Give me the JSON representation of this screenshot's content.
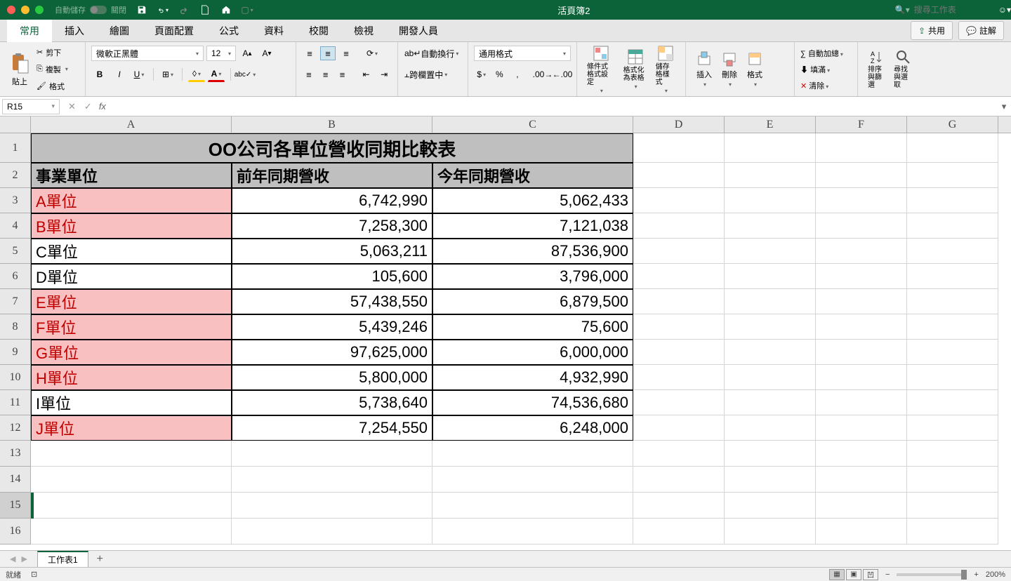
{
  "window": {
    "title": "活頁簿2",
    "autosave_label": "自動儲存",
    "autosave_state": "關閉",
    "search_placeholder": "搜尋工作表"
  },
  "ribbon_tabs": {
    "home": "常用",
    "insert": "插入",
    "draw": "繪圖",
    "page_layout": "頁面配置",
    "formulas": "公式",
    "data": "資料",
    "review": "校閱",
    "view": "檢視",
    "developer": "開發人員",
    "share": "共用",
    "comments": "註解"
  },
  "ribbon": {
    "clipboard": {
      "paste": "貼上",
      "cut": "剪下",
      "copy": "複製",
      "format": "格式"
    },
    "font": {
      "name": "微軟正黑體",
      "size": "12"
    },
    "alignment": {
      "wrap": "自動換行",
      "merge": "跨欄置中"
    },
    "number": {
      "format": "通用格式"
    },
    "styles": {
      "cond": "條件式格式設定",
      "table": "格式化為表格",
      "cell": "儲存格樣式"
    },
    "cells": {
      "insert": "插入",
      "delete": "刪除",
      "format": "格式"
    },
    "editing": {
      "autosum": "自動加總",
      "fill": "填滿",
      "clear": "清除",
      "sort": "排序與篩選",
      "find": "尋找與選取"
    }
  },
  "formula_bar": {
    "name_box": "R15"
  },
  "columns": [
    "A",
    "B",
    "C",
    "D",
    "E",
    "F",
    "G"
  ],
  "data": {
    "title": "OO公司各單位營收同期比較表",
    "h1": "事業單位",
    "h2": "前年同期營收",
    "h3": "今年同期營收",
    "rows": [
      {
        "unit": "A單位",
        "prev": "6,742,990",
        "curr": "5,062,433",
        "hl": true
      },
      {
        "unit": "B單位",
        "prev": "7,258,300",
        "curr": "7,121,038",
        "hl": true
      },
      {
        "unit": "C單位",
        "prev": "5,063,211",
        "curr": "87,536,900",
        "hl": false
      },
      {
        "unit": "D單位",
        "prev": "105,600",
        "curr": "3,796,000",
        "hl": false
      },
      {
        "unit": "E單位",
        "prev": "57,438,550",
        "curr": "6,879,500",
        "hl": true
      },
      {
        "unit": "F單位",
        "prev": "5,439,246",
        "curr": "75,600",
        "hl": true
      },
      {
        "unit": "G單位",
        "prev": "97,625,000",
        "curr": "6,000,000",
        "hl": true
      },
      {
        "unit": "H單位",
        "prev": "5,800,000",
        "curr": "4,932,990",
        "hl": true
      },
      {
        "unit": "I單位",
        "prev": "5,738,640",
        "curr": "74,536,680",
        "hl": false
      },
      {
        "unit": "J單位",
        "prev": "7,254,550",
        "curr": "6,248,000",
        "hl": true
      }
    ]
  },
  "sheet": {
    "tab1": "工作表1"
  },
  "status": {
    "ready": "就緒",
    "zoom": "200%"
  }
}
